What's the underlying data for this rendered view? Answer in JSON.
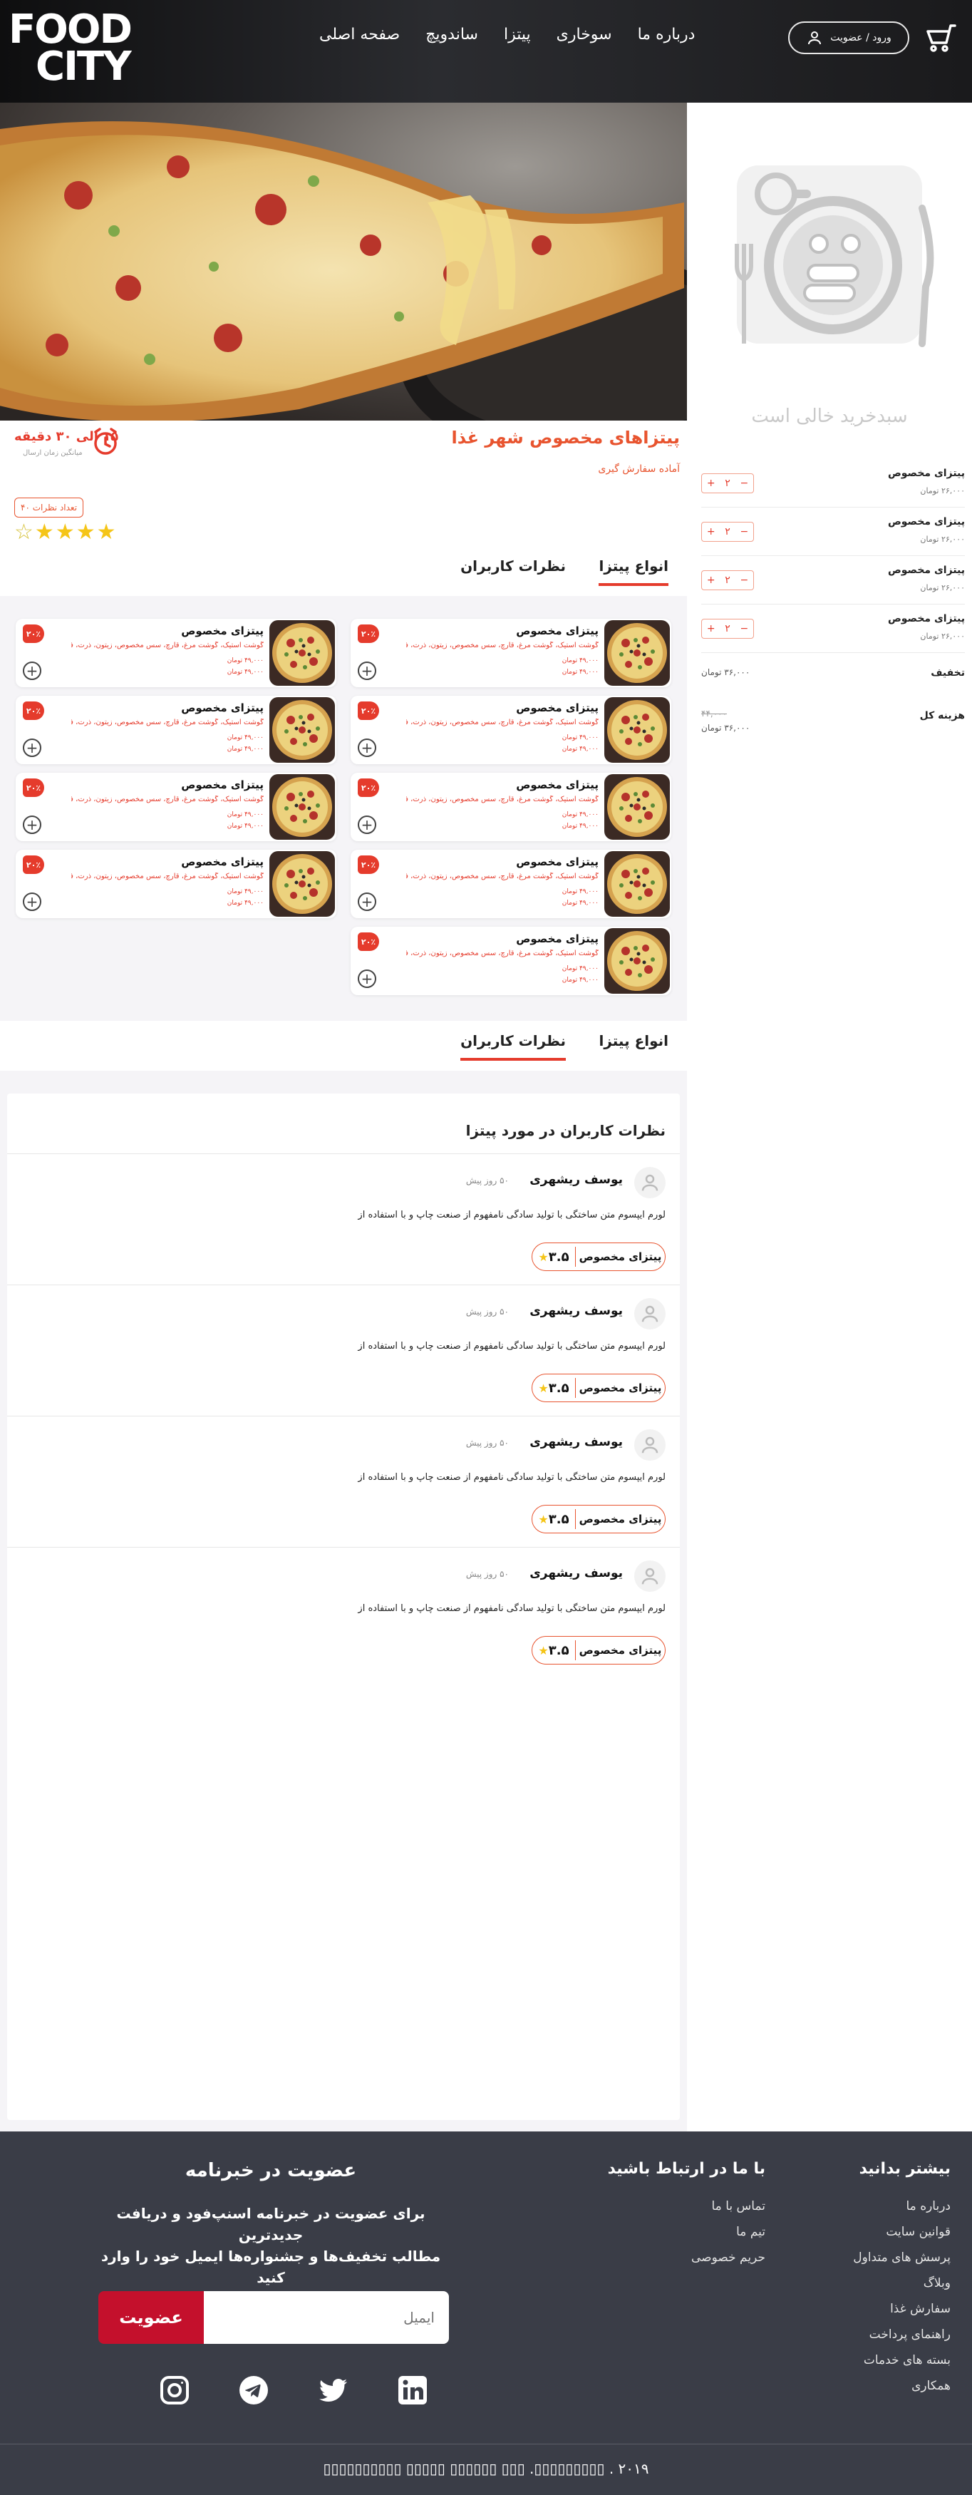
{
  "header": {
    "logo_line1": "FOOD",
    "logo_line2": "CITY",
    "nav": [
      "صفحه اصلی",
      "ساندویچ",
      "پیتزا",
      "سوخاری",
      "درباره ما"
    ],
    "login_label": "ورود / عضویت",
    "cart_icon": "cart-icon",
    "user_icon": "user-icon"
  },
  "cart": {
    "empty_text": "سبدخرید خالی است",
    "items": [
      {
        "name": "پیتزای مخصوص",
        "price": "۲۶,۰۰۰ تومان",
        "qty": "۲"
      },
      {
        "name": "پیتزای مخصوص",
        "price": "۲۶,۰۰۰ تومان",
        "qty": "۲"
      },
      {
        "name": "پیتزای مخصوص",
        "price": "۲۶,۰۰۰ تومان",
        "qty": "۲"
      },
      {
        "name": "پیتزای مخصوص",
        "price": "۲۶,۰۰۰ تومان",
        "qty": "۲"
      }
    ],
    "discount_label": "تخفیف",
    "discount_value": "۳۶,۰۰۰ تومان",
    "total_label": "هزینه کل",
    "total_old": "۴۴,۰۰۰",
    "total_new": "۳۶,۰۰۰ تومان"
  },
  "info": {
    "title": "پیتزاهای مخصوص شهر غذا",
    "subtitle": "آماده سفارش گیری",
    "time": "۱۵ الی ۳۰ دقیقه",
    "time_sub": "میانگین زمان ارسال",
    "reviews_count": "تعداد نظرات ۴۰",
    "rating_stars": 4
  },
  "tabs": {
    "types": "انواع پیتزا",
    "reviews": "نظرات کاربران"
  },
  "products": {
    "name": "پیتزای مخصوص",
    "desc": "گوشت استیک، گوشت مرغ، قارچ، سس مخصوص، زیتون، ذرت، فلفل دلمه",
    "price1": "۴۹,۰۰۰ تومان",
    "price2": "۴۹,۰۰۰ تومان",
    "discount": "۲۰٪",
    "add_label": "+",
    "count_right": 5,
    "count_left": 4
  },
  "reviews": {
    "title": "نظرات کاربران در مورد پیتزا",
    "items": [
      {
        "user": "یوسف ریشهری",
        "ago": "۵۰ روز پیش",
        "text": "لورم ایپسوم متن ساختگی با تولید سادگی نامفهوم از صنعت چاپ و با استفاده از",
        "product": "پیتزای مخصوص",
        "rating": "۳.۵"
      },
      {
        "user": "یوسف ریشهری",
        "ago": "۵۰ روز پیش",
        "text": "لورم ایپسوم متن ساختگی با تولید سادگی نامفهوم از صنعت چاپ و با استفاده از",
        "product": "پیتزای مخصوص",
        "rating": "۳.۵"
      },
      {
        "user": "یوسف ریشهری",
        "ago": "۵۰ روز پیش",
        "text": "لورم ایپسوم متن ساختگی با تولید سادگی نامفهوم از صنعت چاپ و با استفاده از",
        "product": "پیتزای مخصوص",
        "rating": "۳.۵"
      },
      {
        "user": "یوسف ریشهری",
        "ago": "۵۰ روز پیش",
        "text": "لورم ایپسوم متن ساختگی با تولید سادگی نامفهوم از صنعت چاپ و با استفاده از",
        "product": "پیتزای مخصوص",
        "rating": "۳.۵"
      }
    ]
  },
  "footer": {
    "col1_title": "بیشتر بدانید",
    "col1_links": [
      "درباره ما",
      "قوانین سایت",
      "پرسش های متداول",
      "وبلاگ",
      "سفارش غذا",
      "راهنمای پرداخت",
      "بسته های خدمات",
      "همکاری"
    ],
    "col2_title": "با ما در ارتباط باشید",
    "col2_links": [
      "تماس با ما",
      "تیم ما",
      "حریم خصوصی"
    ],
    "newsletter_title": "عضویت در خبرنامه",
    "newsletter_text1": "برای عضویت در خبرنامه اسنپ‌فود و دریافت جدیدترین",
    "newsletter_text2": "مطالب تخفیف‌ها و جشنواره‌ها ایمیل خود را وارد کنید",
    "email_placeholder": "ایمیل",
    "subscribe_label": "عضویت",
    "socials": [
      "instagram-icon",
      "telegram-icon",
      "twitter-icon",
      "linkedin-icon"
    ],
    "copyright": "۲۰۱۹ . ▯▯▯▯▯▯▯▯▯. ▯▯▯ ▯▯▯▯▯▯ ▯▯▯▯▯ ▯▯▯▯▯▯▯▯▯▯"
  },
  "colors": {
    "accent": "#e53b2c",
    "footer_bg": "#3a3d47",
    "subscribe": "#c4102c",
    "star": "#f5c518"
  }
}
